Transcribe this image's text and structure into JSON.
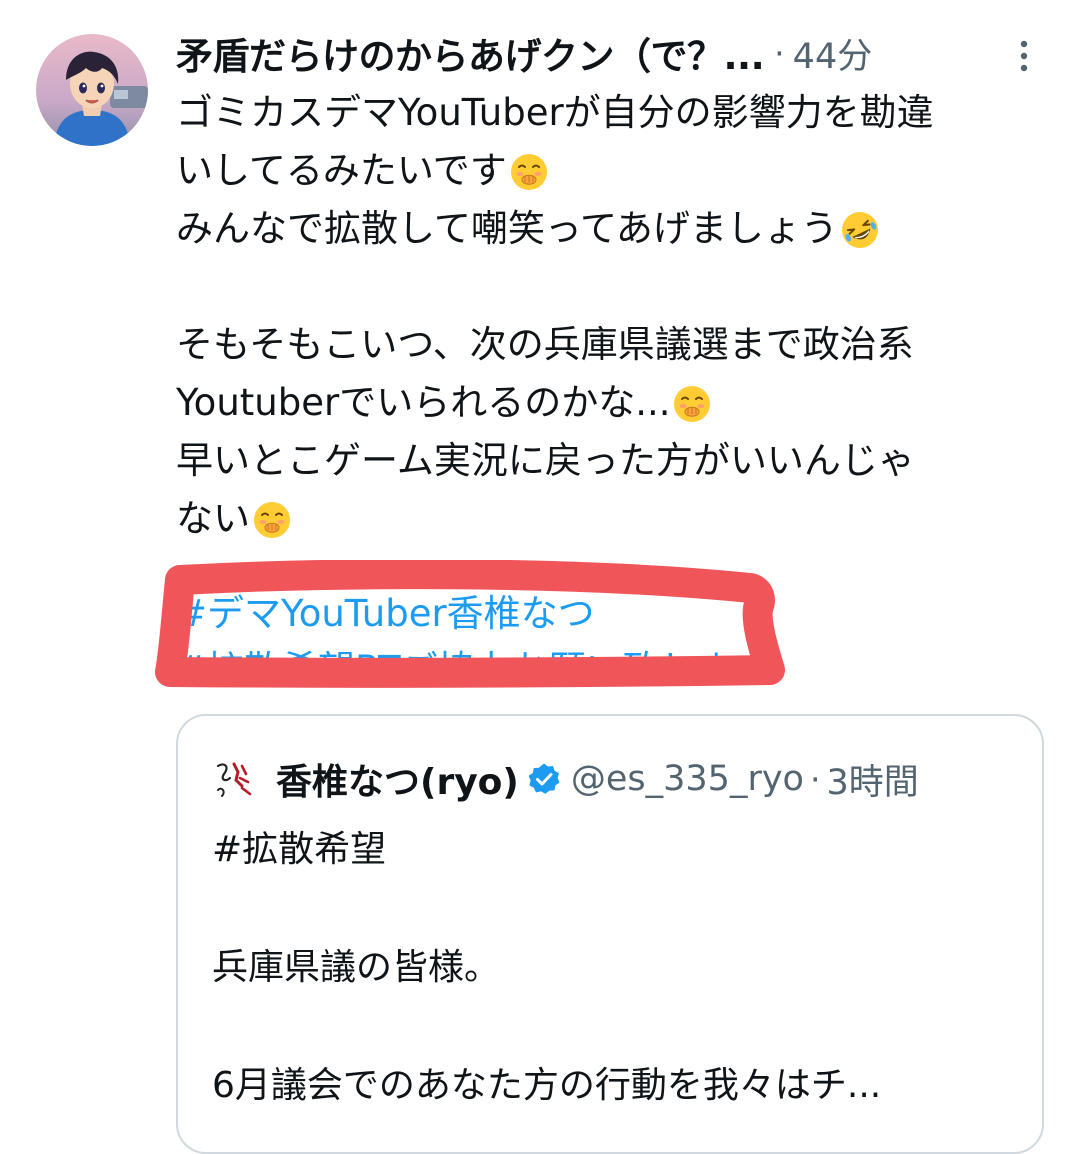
{
  "tweet": {
    "author": {
      "display_name": "矛盾だらけのからあげクン（で？...",
      "avatar_icon": "anime-boy-avatar"
    },
    "separator": "·",
    "timestamp": "44分",
    "more_icon": "vertical-ellipsis-icon",
    "body_lines": [
      {
        "text": "ゴミカスデマYouTuberが自分の影響力を勘違",
        "emoji": ""
      },
      {
        "text": "いしてるみたいです",
        "emoji": "hand-over-mouth-emoji"
      },
      {
        "text": "みんなで拡散して嘲笑ってあげましょう",
        "emoji": "rolling-on-floor-laughing-emoji"
      },
      {
        "text": "",
        "emoji": ""
      },
      {
        "text": "そもそもこいつ、次の兵庫県議選まで政治系",
        "emoji": ""
      },
      {
        "text": "Youtuberでいられるのかな...",
        "emoji": "hand-over-mouth-emoji"
      },
      {
        "text": "早いとこゲーム実況に戻った方がいいんじゃ",
        "emoji": ""
      },
      {
        "text": "ない",
        "emoji": "hand-over-mouth-emoji"
      }
    ],
    "hashtags": [
      "#デマYouTuber香椎なつ",
      "#拡散希望RTご協力お願い致します"
    ],
    "redaction_color": "#f0555a",
    "link_color": "#1d9bf0"
  },
  "quoted_tweet": {
    "avatar_icon": "signature-logo-avatar",
    "display_name": "香椎なつ(ryo)",
    "verified_icon": "verified-badge-icon",
    "handle": "@es_335_ryo",
    "separator": "·",
    "timestamp": "3時間",
    "body_lines": [
      "#拡散希望",
      "",
      "兵庫県議の皆様。",
      "",
      "6月議会でのあなた方の行動を我々はチ..."
    ]
  }
}
